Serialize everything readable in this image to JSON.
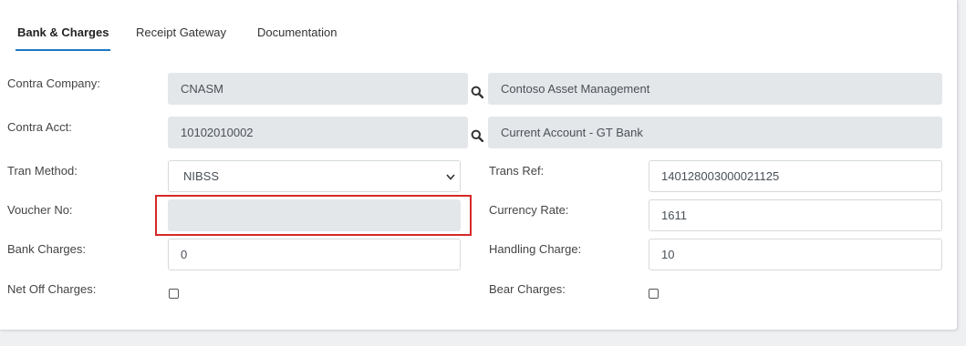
{
  "tabs": [
    {
      "label": "Bank & Charges",
      "active": true
    },
    {
      "label": "Receipt Gateway",
      "active": false
    },
    {
      "label": "Documentation",
      "active": false
    }
  ],
  "form": {
    "contra_company": {
      "label": "Contra Company:",
      "code": "CNASM",
      "name": "Contoso Asset Management"
    },
    "contra_acct": {
      "label": "Contra Acct:",
      "code": "10102010002",
      "name": "Current Account - GT Bank"
    },
    "tran_method": {
      "label": "Tran Method:",
      "value": "NIBSS"
    },
    "trans_ref": {
      "label": "Trans Ref:",
      "value": "140128003000021125"
    },
    "voucher_no": {
      "label": "Voucher No:",
      "value": ""
    },
    "currency_rate": {
      "label": "Currency Rate:",
      "value": "1611"
    },
    "bank_charges": {
      "label": "Bank Charges:",
      "value": "0"
    },
    "handling_charge": {
      "label": "Handling Charge:",
      "value": "10"
    },
    "net_off_charges": {
      "label": "Net Off Charges:",
      "checked": false
    },
    "bear_charges": {
      "label": "Bear Charges:",
      "checked": false
    }
  },
  "colors": {
    "accent": "#1c77c3",
    "readonly_bg": "#e4e7ea",
    "highlight": "#d62828"
  },
  "icons": {
    "lookup": "search-icon",
    "dropdown": "chevron-down-icon"
  }
}
